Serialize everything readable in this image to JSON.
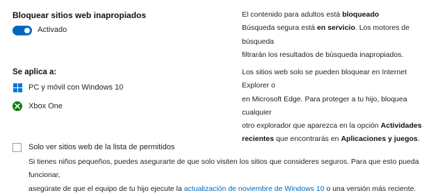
{
  "block": {
    "title": "Bloquear sitios web inapropiados",
    "toggle_state": "on",
    "toggle_label": "Activado",
    "desc_line1_pre": "El contenido para adultos está ",
    "desc_line1_bold": "bloqueado",
    "desc_line2_pre": "Búsqueda segura está ",
    "desc_line2_bold": "en servicio",
    "desc_line2_post": ". Los motores de búsqueda",
    "desc_line3": "filtrarán los resultados de búsqueda inapropiados."
  },
  "applies": {
    "title": "Se aplica a:",
    "devices": [
      {
        "label": "PC y móvil con Windows 10",
        "icon": "windows-icon"
      },
      {
        "label": "Xbox One",
        "icon": "xbox-icon"
      }
    ],
    "info_line1": "Los sitios web solo se pueden bloquear en Internet Explorer o",
    "info_line2": "en Microsoft Edge. Para proteger a tu hijo, bloquea cualquier",
    "info_line3_pre": "otro explorador que aparezca en la opción ",
    "info_line3_bold": "Actividades",
    "info_line4_bold1": "recientes",
    "info_line4_mid": " que encontrarás en ",
    "info_line4_bold2": "Aplicaciones y juegos",
    "info_line4_post": "."
  },
  "allowlist": {
    "checkbox_label": "Solo ver sitios web de la lista de permitidos",
    "checked": false,
    "desc_line1": "Si tienes niños pequeños, puedes asegurarte de que solo visiten los sitios que consideres seguros. Para que esto pueda funcionar,",
    "desc_line2_pre": "asegúrate de que el equipo de tu hijo ejecute la ",
    "desc_link": "actualización de noviembre de Windows 10",
    "desc_line2_post": " o una versión más reciente."
  },
  "colors": {
    "accent": "#0067c0",
    "windows": "#0078d4",
    "xbox": "#107c10",
    "link": "#0067b8"
  }
}
